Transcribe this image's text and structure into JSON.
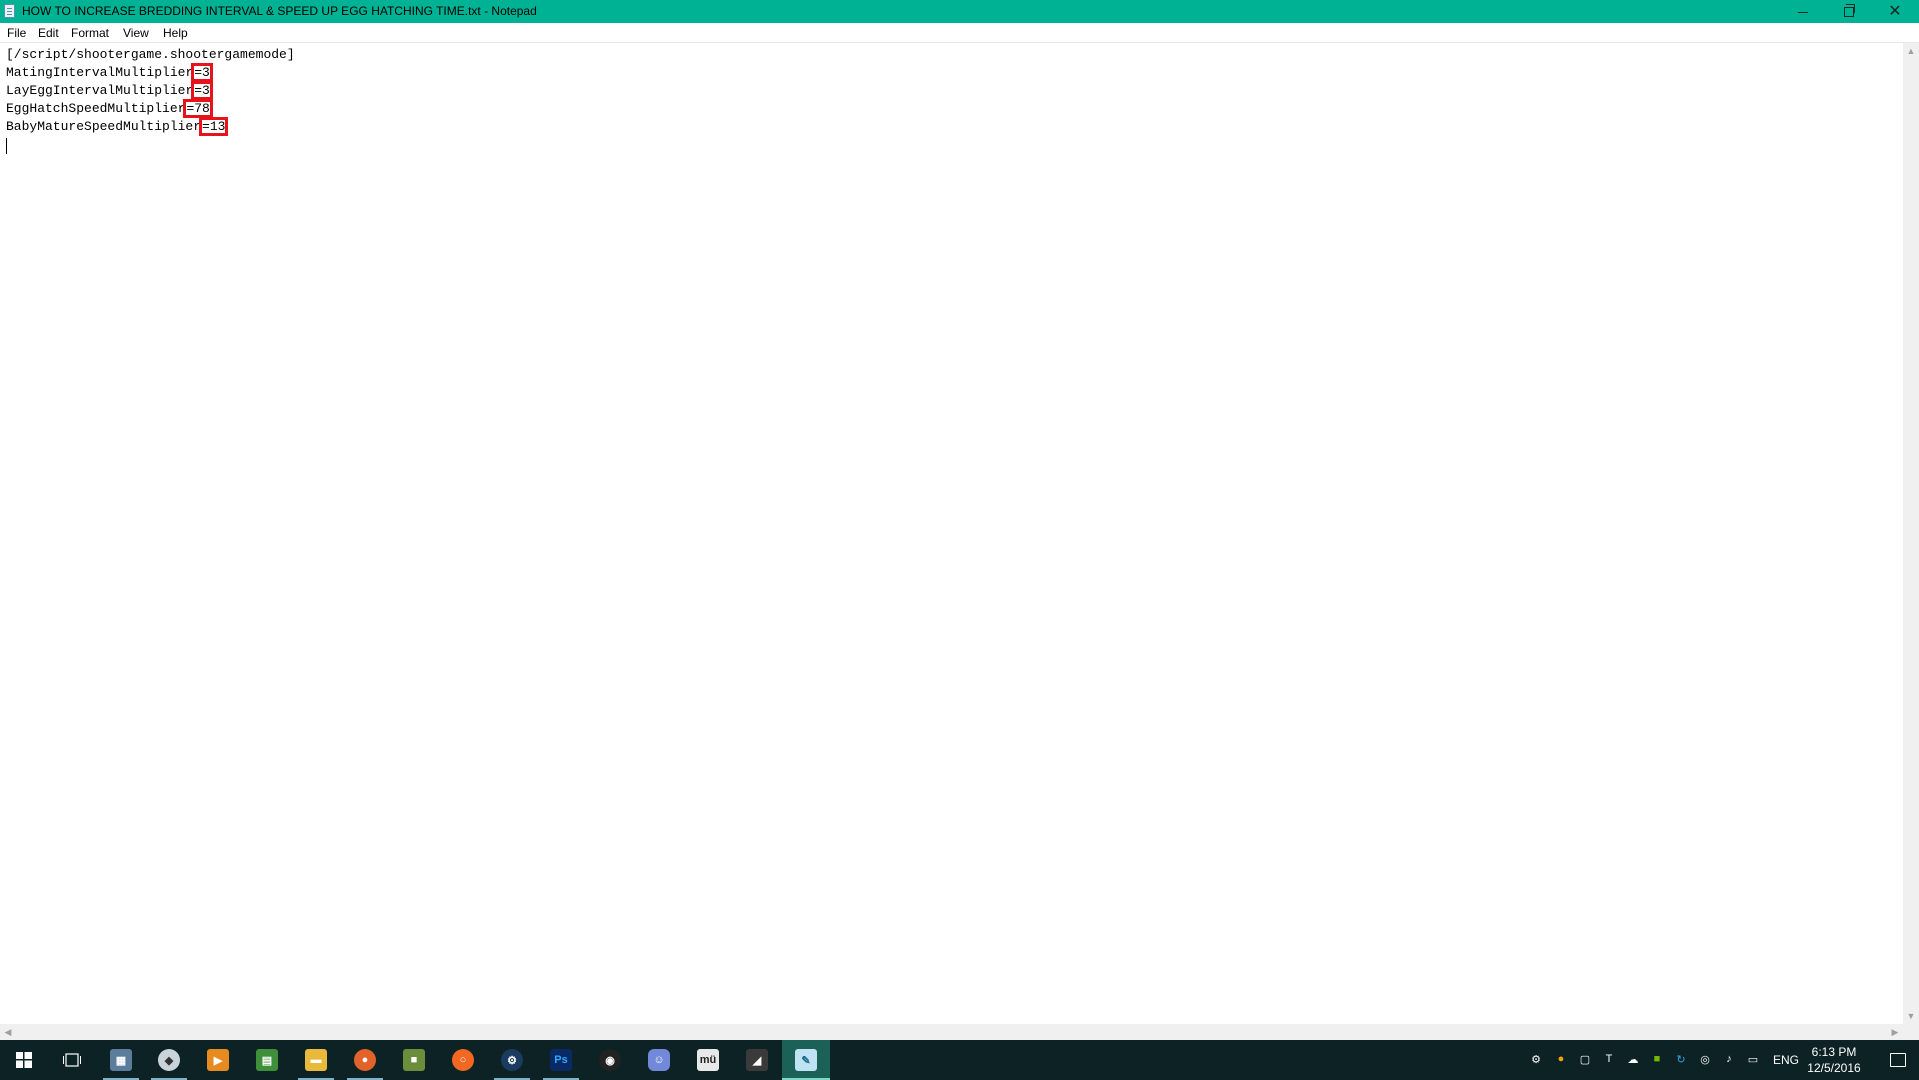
{
  "window": {
    "title": "HOW TO INCREASE BREDDING INTERVAL & SPEED UP EGG HATCHING TIME.txt - Notepad",
    "minimize_glyph": "",
    "close_glyph": "✕"
  },
  "menu": {
    "file": "File",
    "edit": "Edit",
    "format": "Format",
    "view": "View",
    "help": "Help"
  },
  "document": {
    "lines": [
      {
        "key": "[/script/shootergame.shootergamemode]",
        "value": ""
      },
      {
        "key": "MatingIntervalMultiplier",
        "value": "=3"
      },
      {
        "key": "LayEggIntervalMultiplier",
        "value": "=3"
      },
      {
        "key": "EggHatchSpeedMultiplier",
        "value": "=78"
      },
      {
        "key": "BabyMatureSpeedMultiplier",
        "value": "=13"
      }
    ],
    "highlight_color": "#e8121b"
  },
  "taskbar": {
    "apps": [
      {
        "name": "start-icon"
      },
      {
        "name": "task-view-icon"
      },
      {
        "name": "photos-app-icon"
      },
      {
        "name": "shield-app-icon"
      },
      {
        "name": "media-player-icon"
      },
      {
        "name": "spreadsheet-app-icon"
      },
      {
        "name": "file-explorer-icon"
      },
      {
        "name": "firefox-icon"
      },
      {
        "name": "minecraft-icon"
      },
      {
        "name": "origin-icon"
      },
      {
        "name": "steam-icon"
      },
      {
        "name": "photoshop-icon",
        "label": "Ps"
      },
      {
        "name": "obs-icon"
      },
      {
        "name": "discord-icon"
      },
      {
        "name": "mu-app-icon",
        "label": "mü"
      },
      {
        "name": "game-app-icon"
      },
      {
        "name": "notepad-icon"
      }
    ],
    "tray": {
      "language": "ENG",
      "time": "6:13 PM",
      "date": "12/5/2016"
    }
  }
}
